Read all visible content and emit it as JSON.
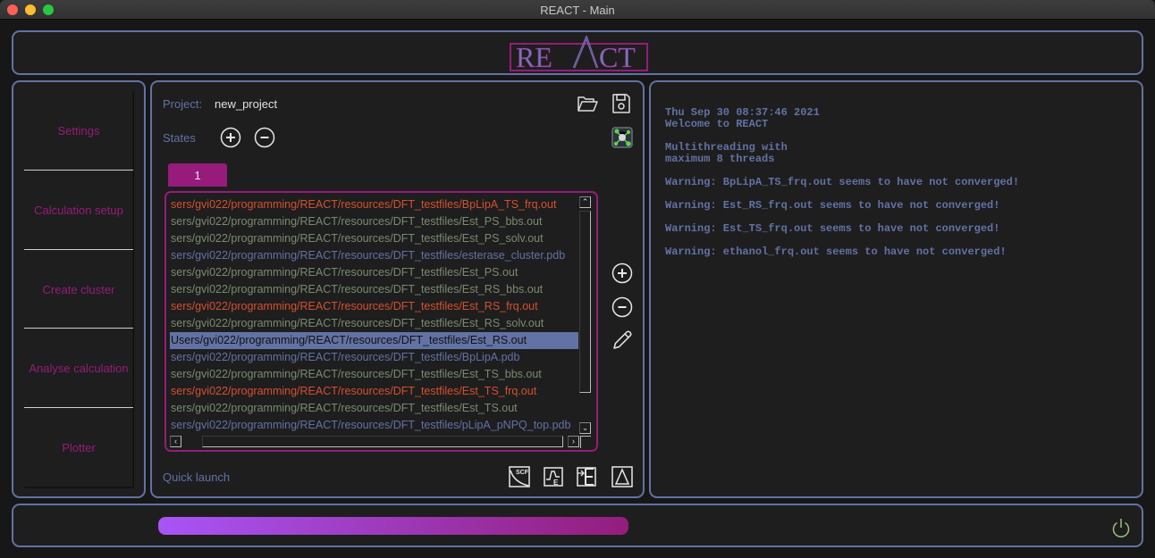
{
  "window": {
    "title": "REACT - Main"
  },
  "header": {
    "logo_text": "REACT"
  },
  "sidebar": {
    "items": [
      {
        "label": "Settings"
      },
      {
        "label": "Calculation setup"
      },
      {
        "label": "Create cluster"
      },
      {
        "label": "Analyse calculation"
      },
      {
        "label": "Plotter"
      }
    ]
  },
  "project": {
    "label": "Project:",
    "name": "new_project",
    "states_label": "States",
    "tabs": [
      {
        "label": "1",
        "active": true
      }
    ],
    "files": [
      {
        "path": "sers/gvi022/programming/REACT/resources/DFT_testfiles/BpLipA_TS_frq.out",
        "status": "not-converged"
      },
      {
        "path": "sers/gvi022/programming/REACT/resources/DFT_testfiles/Est_PS_bbs.out",
        "status": "output"
      },
      {
        "path": "sers/gvi022/programming/REACT/resources/DFT_testfiles/Est_PS_solv.out",
        "status": "output"
      },
      {
        "path": "sers/gvi022/programming/REACT/resources/DFT_testfiles/esterase_cluster.pdb",
        "status": "pdb"
      },
      {
        "path": "sers/gvi022/programming/REACT/resources/DFT_testfiles/Est_PS.out",
        "status": "output"
      },
      {
        "path": "sers/gvi022/programming/REACT/resources/DFT_testfiles/Est_RS_bbs.out",
        "status": "output"
      },
      {
        "path": "sers/gvi022/programming/REACT/resources/DFT_testfiles/Est_RS_frq.out",
        "status": "not-converged"
      },
      {
        "path": "sers/gvi022/programming/REACT/resources/DFT_testfiles/Est_RS_solv.out",
        "status": "output"
      },
      {
        "path": "Users/gvi022/programming/REACT/resources/DFT_testfiles/Est_RS.out",
        "status": "selected"
      },
      {
        "path": "sers/gvi022/programming/REACT/resources/DFT_testfiles/BpLipA.pdb",
        "status": "pdb"
      },
      {
        "path": "sers/gvi022/programming/REACT/resources/DFT_testfiles/Est_TS_bbs.out",
        "status": "output"
      },
      {
        "path": "sers/gvi022/programming/REACT/resources/DFT_testfiles/Est_TS_frq.out",
        "status": "not-converged"
      },
      {
        "path": "sers/gvi022/programming/REACT/resources/DFT_testfiles/Est_TS.out",
        "status": "output"
      },
      {
        "path": "sers/gvi022/programming/REACT/resources/DFT_testfiles/pLipA_pNPQ_top.pdb",
        "status": "pdb"
      }
    ],
    "quick_launch_label": "Quick launch",
    "quick_launch_icons": [
      "scf-icon",
      "energy-icon",
      "import-energy-icon",
      "delta-icon"
    ]
  },
  "colors": {
    "accent_blue": "#6272a4",
    "accent_magenta": "#961b7b",
    "not_converged": "#d4502f",
    "output_file": "#7b8a70",
    "pdb_file": "#6272a4",
    "power_icon": "#9bc27a"
  },
  "log": {
    "lines": [
      "Thu Sep 30 08:37:46 2021",
      "Welcome to REACT",
      "",
      "Multithreading with",
      "maximum 8 threads",
      "",
      "Warning: BpLipA_TS_frq.out seems to have not converged!",
      "",
      "Warning: Est_RS_frq.out seems to have not converged!",
      "",
      "Warning: Est_TS_frq.out seems to have not converged!",
      "",
      "Warning: ethanol_frq.out seems to have not converged!"
    ]
  },
  "footer": {
    "progress_percent": 100
  }
}
